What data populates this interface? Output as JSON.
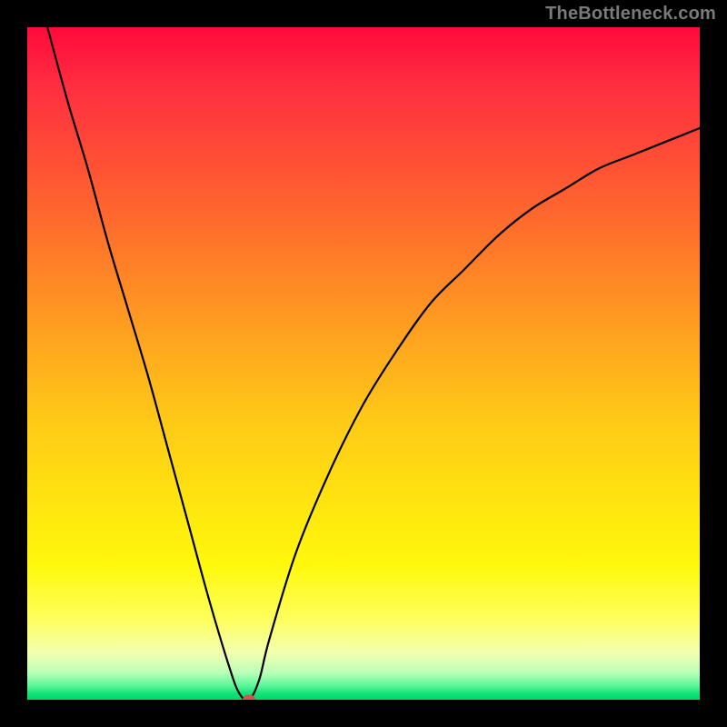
{
  "watermark": "TheBottleneck.com",
  "chart_data": {
    "type": "line",
    "title": "",
    "xlabel": "",
    "ylabel": "",
    "xlim": [
      0,
      100
    ],
    "ylim": [
      0,
      100
    ],
    "grid": false,
    "series": [
      {
        "name": "curve",
        "x": [
          3,
          6,
          9,
          12,
          15,
          18,
          21,
          24,
          27,
          30,
          31.5,
          33,
          34.5,
          36,
          40,
          45,
          50,
          55,
          60,
          65,
          70,
          75,
          80,
          85,
          90,
          95,
          100
        ],
        "y": [
          100,
          89,
          79,
          68,
          58,
          48,
          37,
          26,
          15,
          5,
          1,
          0,
          3,
          9,
          22,
          34,
          44,
          52,
          59,
          64,
          69,
          73,
          76,
          79,
          81,
          83,
          85
        ]
      }
    ],
    "marker": {
      "x": 33,
      "y": 0,
      "color": "#cc5a53"
    },
    "background_gradient": {
      "top": "#ff0a3a",
      "mid": "#ffe310",
      "bottom": "#00d968"
    }
  }
}
